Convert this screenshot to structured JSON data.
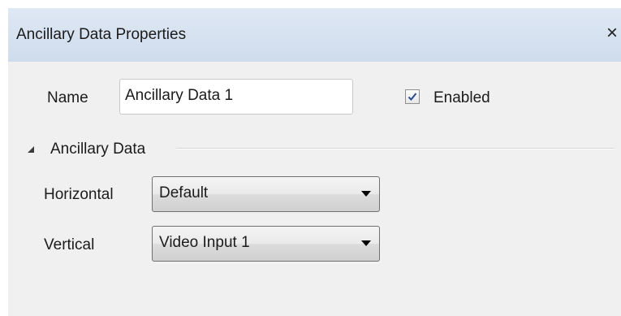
{
  "window": {
    "title": "Ancillary Data Properties",
    "close_icon": "×"
  },
  "name_row": {
    "label": "Name",
    "value": "Ancillary Data 1",
    "enabled_label": "Enabled",
    "enabled_checked": true
  },
  "section": {
    "title": "Ancillary Data",
    "expanded": true
  },
  "horizontal": {
    "label": "Horizontal",
    "selected": "Default"
  },
  "vertical": {
    "label": "Vertical",
    "selected": "Video Input 1"
  }
}
